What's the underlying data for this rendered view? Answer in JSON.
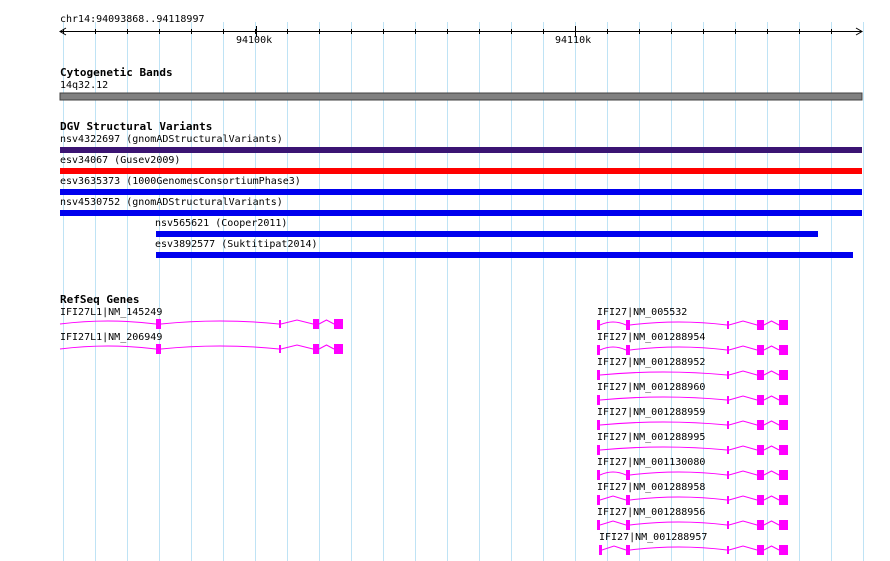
{
  "ruler": {
    "range_label": "chr14:94093868..94118997",
    "ticks": [
      {
        "label": "94100k",
        "pos": 94100000
      },
      {
        "label": "94110k",
        "pos": 94110000
      }
    ]
  },
  "genome": {
    "start": 94093868,
    "end": 94118997
  },
  "tracks": {
    "cytoband": {
      "title": "Cytogenetic Bands",
      "band_label": "14q32.12"
    },
    "dgv": {
      "title": "DGV Structural Variants",
      "variants": [
        {
          "label": "nsv4322697 (gnomADStructuralVariants)",
          "color": "#3b1473",
          "start": 94093868,
          "end": 94118997
        },
        {
          "label": "esv34067 (Gusev2009)",
          "color": "#ff0000",
          "start": 94093868,
          "end": 94118997
        },
        {
          "label": "esv3635373 (1000GenomesConsortiumPhase3)",
          "color": "#0000ee",
          "start": 94093868,
          "end": 94118997
        },
        {
          "label": "nsv4530752 (gnomADStructuralVariants)",
          "color": "#0000ee",
          "start": 94093868,
          "end": 94118997
        },
        {
          "label": "nsv565621 (Cooper2011)",
          "color": "#0000ee",
          "start": 94096880,
          "end": 94117610
        },
        {
          "label": "esv3892577 (Suktitipat2014)",
          "color": "#0000ee",
          "start": 94096880,
          "end": 94118700
        }
      ]
    },
    "refseq": {
      "title": "RefSeq Genes",
      "color": "#ff00ff",
      "genes": [
        {
          "label": "IFI27L1|NM_145249"
        },
        {
          "label": "IFI27L1|NM_206949"
        },
        {
          "label": "IFI27|NM_005532"
        },
        {
          "label": "IFI27|NM_001288954"
        },
        {
          "label": "IFI27|NM_001288952"
        },
        {
          "label": "IFI27|NM_001288960"
        },
        {
          "label": "IFI27|NM_001288959"
        },
        {
          "label": "IFI27|NM_001288995"
        },
        {
          "label": "IFI27|NM_001130080"
        },
        {
          "label": "IFI27|NM_001288958"
        },
        {
          "label": "IFI27|NM_001288956"
        },
        {
          "label": "IFI27|NM_001288957"
        }
      ]
    }
  }
}
